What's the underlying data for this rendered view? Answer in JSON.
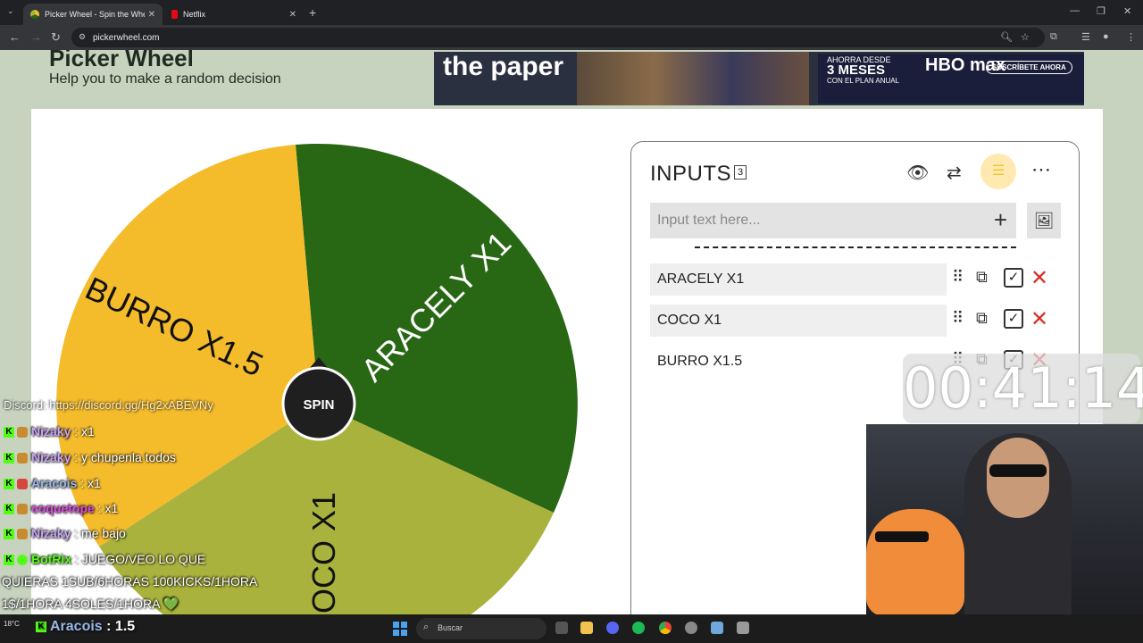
{
  "browser": {
    "tabs": [
      {
        "title": "Picker Wheel - Spin the Wheel t",
        "active": true,
        "icon": "picker-wheel-favicon"
      },
      {
        "title": "Netflix",
        "active": false,
        "icon": "netflix-favicon"
      }
    ],
    "url": "pickerwheel.com"
  },
  "header": {
    "title": "Picker Wheel",
    "subtitle": "Help you to make a random decision"
  },
  "ad": {
    "headline": "the paper",
    "promo_small": "AHORRA DESDE",
    "promo_big": "3 MESES",
    "promo_plan": "CON EL PLAN ANUAL",
    "brand": "HBO max",
    "cta": "SUSCRÍBETE AHORA"
  },
  "wheel": {
    "spin_label": "SPIN",
    "colors": {
      "yellow": "#f4bb2b",
      "dark_green": "#286713",
      "olive": "#a9b23c",
      "hub": "#1f1f1f"
    },
    "segments": [
      {
        "label": "ARACELY X1",
        "color": "#286713",
        "text_color": "#ffffff"
      },
      {
        "label": "COCO X1",
        "color": "#a9b23c",
        "text_color": "#111111"
      },
      {
        "label": "BURRO X1.5",
        "color": "#f4bb2b",
        "text_color": "#111111"
      }
    ]
  },
  "inputs_panel": {
    "title": "INPUTS",
    "count": "3",
    "placeholder": "Input text here...",
    "entries": [
      {
        "label": "ARACELY X1"
      },
      {
        "label": "COCO X1"
      },
      {
        "label": "BURRO X1.5"
      }
    ]
  },
  "overlay": {
    "timer": "00:41:14",
    "chat_header": "Discord: https://discord.gg/Hg2xABEVNy",
    "chat": [
      {
        "user": "Nizaky",
        "message": ": x1",
        "user_color": "#c9a4f5",
        "badge": "#c98b2f"
      },
      {
        "user": "Nizaky",
        "message": ": y chupenla todos",
        "user_color": "#c9a4f5",
        "badge": "#c98b2f"
      },
      {
        "user": "Aracois",
        "message": ": x1",
        "user_color": "#9ab7e8",
        "badge": "#d9463f"
      },
      {
        "user": "coquetope",
        "message": ": x1",
        "user_color": "#e14be0",
        "badge": "#c98b2f"
      },
      {
        "user": "Nizaky",
        "message": ": me bajo",
        "user_color": "#c9a4f5",
        "badge": "#c98b2f"
      },
      {
        "user": "BotRix",
        "message": ": JUEGO/VEO LO QUE",
        "user_color": "#53fc18",
        "badge": "#53fc18"
      }
    ],
    "chat_continued_1": "QUIERAS 1SUB/6HORAS 100KICKS/1HORA",
    "chat_continued_2": "1$/1HORA 4SOLES/1HORA 💚",
    "bottom_user": "Aracois",
    "bottom_message": ": 1.5"
  },
  "taskbar": {
    "search_placeholder": "Buscar",
    "weather": "18°C"
  }
}
